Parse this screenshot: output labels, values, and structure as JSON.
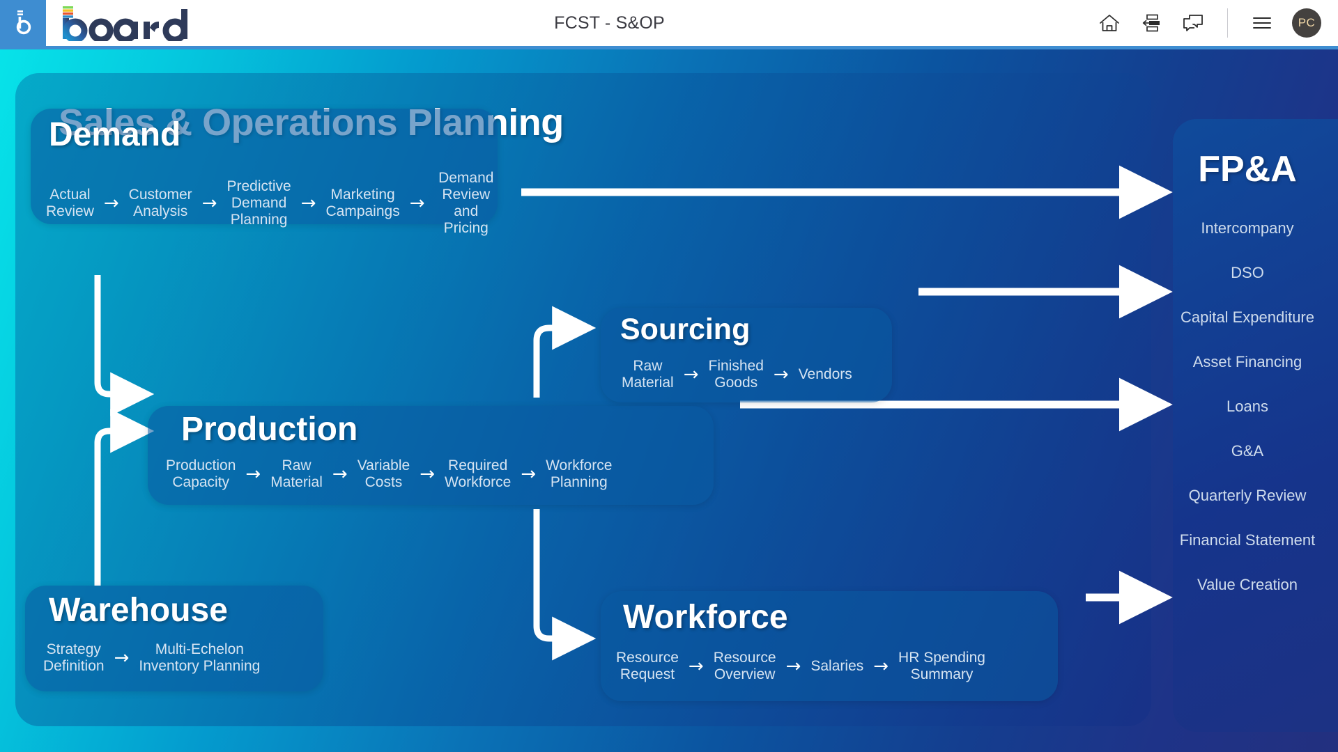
{
  "header": {
    "brand_name": "board",
    "title": "FCST - S&OP",
    "icons": [
      {
        "name": "home-icon",
        "label": "Home"
      },
      {
        "name": "layout-icon",
        "label": "Layout"
      },
      {
        "name": "chat-icon",
        "label": "Comments"
      },
      {
        "name": "hamburger-menu-icon",
        "label": "Menu"
      }
    ],
    "avatar_initials": "PC"
  },
  "board": {
    "title": "Sales & Operations Planning",
    "cards": [
      {
        "id": "demand",
        "title": "Demand",
        "steps": [
          "Actual\nReview",
          "Customer\nAnalysis",
          "Predictive\nDemand\nPlanning",
          "Marketing\nCampaings",
          "Demand\nReview\nand Pricing"
        ]
      },
      {
        "id": "sourcing",
        "title": "Sourcing",
        "steps": [
          "Raw\nMaterial",
          "Finished\nGoods",
          "Vendors"
        ]
      },
      {
        "id": "production",
        "title": "Production",
        "steps": [
          "Production\nCapacity",
          "Raw\nMaterial",
          "Variable\nCosts",
          "Required\nWorkforce",
          "Workforce\nPlanning"
        ]
      },
      {
        "id": "warehouse",
        "title": "Warehouse",
        "steps": [
          "Strategy\nDefinition",
          "Multi-Echelon\nInventory Planning"
        ]
      },
      {
        "id": "workforce",
        "title": "Workforce",
        "steps": [
          "Resource\nRequest",
          "Resource\nOverview",
          "Salaries",
          "HR Spending\nSummary"
        ]
      }
    ],
    "step_arrow_glyph": "→"
  },
  "fpa": {
    "title": "FP&A",
    "items": [
      "Intercompany",
      "DSO",
      "Capital Expenditure",
      "Asset Financing",
      "Loans",
      "G&A",
      "Quarterly Review",
      "Financial Statement",
      "Value Creation"
    ]
  },
  "colors": {
    "brand_blue": "#3E8DD1",
    "canvas_cyan": "#07E3E9",
    "canvas_deep_blue": "#23307F",
    "card_blue": "#0A5AA0",
    "arrow_white": "#FFFFFF",
    "step_text": "#D6E4F2",
    "avatar_bg": "#44413F",
    "avatar_text": "#F3D9A8"
  }
}
